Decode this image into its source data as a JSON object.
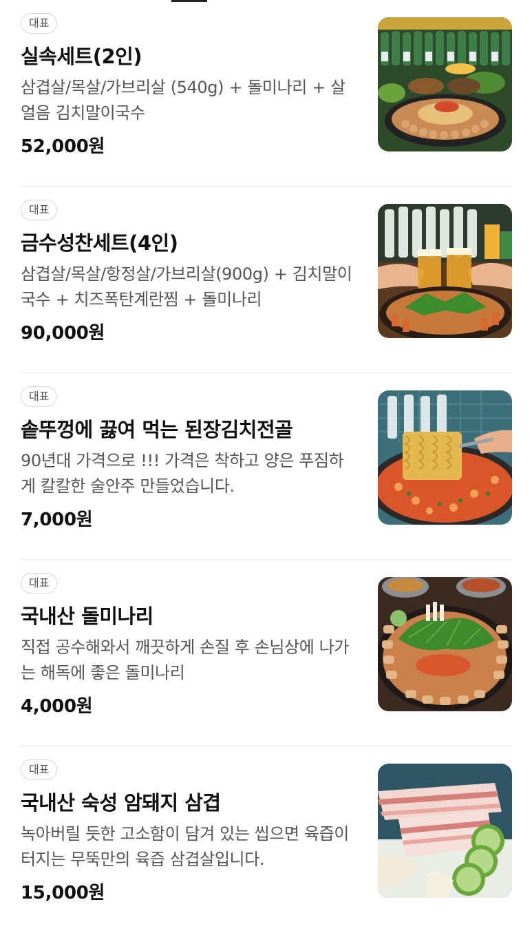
{
  "menu": {
    "items": [
      {
        "badge": "대표",
        "name": "실속세트(2인)",
        "desc": "삼겹살/목살/가브리살 (540g) + 돌미나리 + 살얼음 김치말이국수",
        "price": "52,000원",
        "image": "bbq-set-photo"
      },
      {
        "badge": "대표",
        "name": "금수성찬세트(4인)",
        "desc": "삼겹살/목살/항정살/가브리살(900g) + 김치말이국수 + 치즈폭탄계란찜 + 돌미나리",
        "price": "90,000원",
        "image": "beer-toast-bbq-photo"
      },
      {
        "badge": "대표",
        "name": "솥뚜껑에 끓여 먹는 된장김치전골",
        "desc": "90년대 가격으로 !!! 가격은 착하고 양은 푸짐하게 칼칼한 술안주 만들었습니다.",
        "price": "7,000원",
        "image": "stew-noodle-photo"
      },
      {
        "badge": "대표",
        "name": "국내산 돌미나리",
        "desc": "직접 공수해와서 깨끗하게 손질 후 손님상에 나가는 해독에 좋은 돌미나리",
        "price": "4,000원",
        "image": "water-parsley-grill-photo"
      },
      {
        "badge": "대표",
        "name": "국내산 숙성 암돼지 삼겹",
        "desc": "녹아버릴 듯한 고소함이 담겨 있는 씹으면 육즙이 터지는 무뚝만의 육즙 삼겹살입니다.",
        "price": "15,000원",
        "image": "pork-belly-photo"
      }
    ]
  },
  "colors": {
    "text": "#111111",
    "subtext": "#555555",
    "divider": "#ececec",
    "badge_border": "#d7d7d7"
  }
}
